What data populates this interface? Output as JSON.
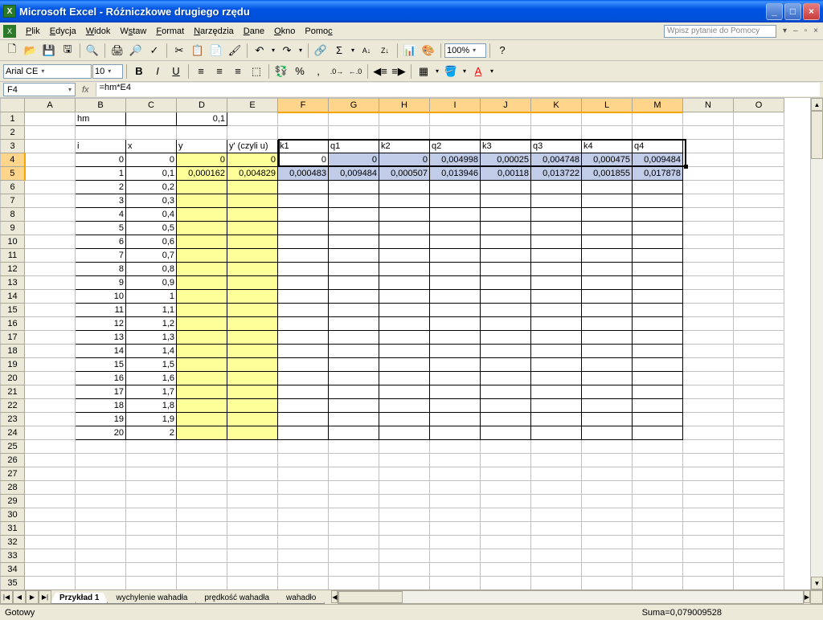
{
  "titlebar": {
    "app": "Microsoft Excel",
    "doc": "Różniczkowe drugiego rzędu"
  },
  "menus": {
    "file": "Plik",
    "edit": "Edycja",
    "view": "Widok",
    "insert": "Wstaw",
    "format": "Format",
    "tools": "Narzędzia",
    "data": "Dane",
    "window": "Okno",
    "help": "Pomoc",
    "helpbox": "Wpisz pytanie do Pomocy"
  },
  "toolbar": {
    "zoom": "100%"
  },
  "format": {
    "font": "Arial CE",
    "size": "10"
  },
  "formulabar": {
    "cellref": "F4",
    "formula": "=hm*E4"
  },
  "columns": [
    "A",
    "B",
    "C",
    "D",
    "E",
    "F",
    "G",
    "H",
    "I",
    "J",
    "K",
    "L",
    "M",
    "N",
    "O"
  ],
  "cells": {
    "B1": "hm",
    "D1": "0,1",
    "B3": "i",
    "C3": "x",
    "D3": "y",
    "E3": "y' (czyli u)",
    "F3": "k1",
    "G3": "q1",
    "H3": "k2",
    "I3": "q2",
    "J3": "k3",
    "K3": "q3",
    "L3": "k4",
    "M3": "q4",
    "B4": "0",
    "C4": "0",
    "D4": "0",
    "E4": "0",
    "F4": "0",
    "G4": "0",
    "H4": "0",
    "I4": "0,004998",
    "J4": "0,00025",
    "K4": "0,004748",
    "L4": "0,000475",
    "M4": "0,009484",
    "B5": "1",
    "C5": "0,1",
    "D5": "0,000162",
    "E5": "0,004829",
    "F5": "0,000483",
    "G5": "0,009484",
    "H5": "0,000507",
    "I5": "0,013946",
    "J5": "0,00118",
    "K5": "0,013722",
    "L5": "0,001855",
    "M5": "0,017878",
    "B6": "2",
    "C6": "0,2",
    "B7": "3",
    "C7": "0,3",
    "B8": "4",
    "C8": "0,4",
    "B9": "5",
    "C9": "0,5",
    "B10": "6",
    "C10": "0,6",
    "B11": "7",
    "C11": "0,7",
    "B12": "8",
    "C12": "0,8",
    "B13": "9",
    "C13": "0,9",
    "B14": "10",
    "C14": "1",
    "B15": "11",
    "C15": "1,1",
    "B16": "12",
    "C16": "1,2",
    "B17": "13",
    "C17": "1,3",
    "B18": "14",
    "C18": "1,4",
    "B19": "15",
    "C19": "1,5",
    "B20": "16",
    "C20": "1,6",
    "B21": "17",
    "C21": "1,7",
    "B22": "18",
    "C22": "1,8",
    "B23": "19",
    "C23": "1,9",
    "B24": "20",
    "C24": "2"
  },
  "tabs": {
    "t1": "Przykład 1",
    "t2": "wychylenie wahadła",
    "t3": "prędkość wahadła",
    "t4": "wahadło"
  },
  "status": {
    "ready": "Gotowy",
    "sum": "Suma=0,079009528"
  }
}
